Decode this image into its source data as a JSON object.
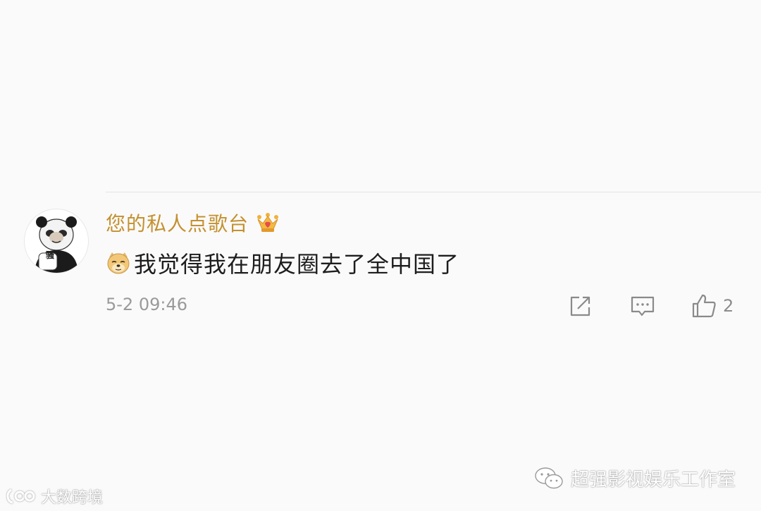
{
  "comment": {
    "username": "您的私人点歌台",
    "username_color": "#c3912f",
    "badge_icon": "crown-icon",
    "emoji_icon": "doge-icon",
    "text": "我觉得我在朋友圈去了全中国了",
    "timestamp": "5-2 09:46",
    "avatar_tag": "骚",
    "like_count": "2"
  },
  "actions": {
    "share_icon": "share-icon",
    "reply_icon": "reply-icon",
    "like_icon": "thumbs-up-icon"
  },
  "watermarks": {
    "right_text": "超强影视娱乐工作室",
    "left_text": "大数跨境"
  }
}
